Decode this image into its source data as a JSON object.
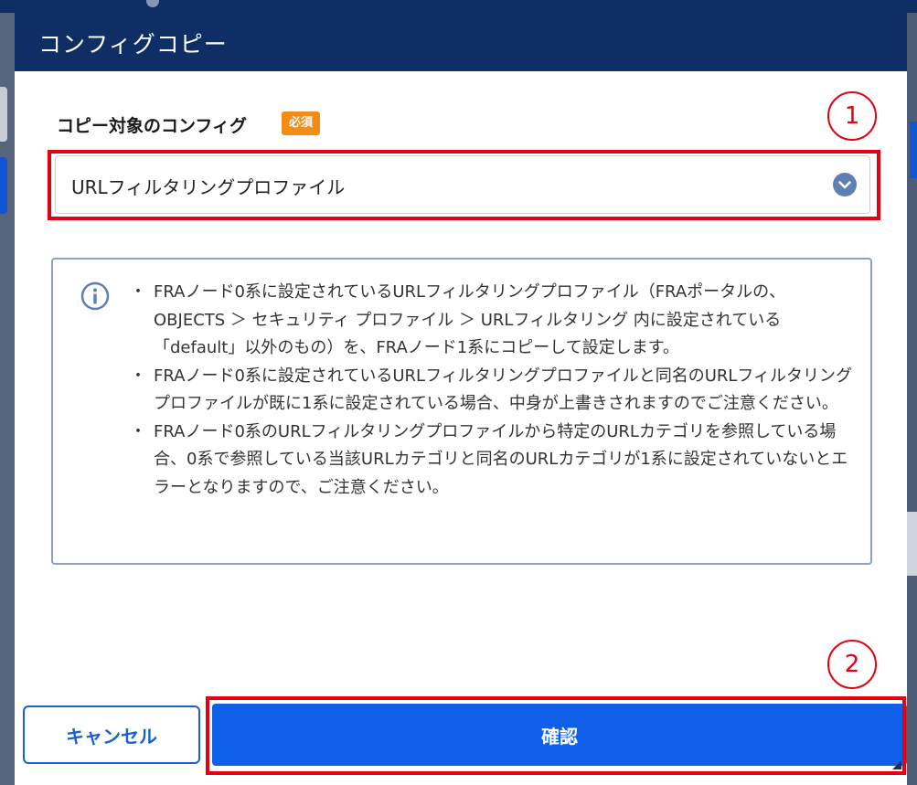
{
  "modal": {
    "title": "コンフィグコピー",
    "field_label": "コピー対象のコンフィグ",
    "required_badge": "必須",
    "select_value": "URLフィルタリングプロファイル",
    "info_notes": [
      "FRAノード0系に設定されているURLフィルタリングプロファイル（FRAポータルの、OBJECTS ＞ セキュリティ プロファイル ＞ URLフィルタリング 内に設定されている「default」以外のもの）を、FRAノード1系にコピーして設定します。",
      "FRAノード0系に設定されているURLフィルタリングプロファイルと同名のURLフィルタリングプロファイルが既に1系に設定されている場合、中身が上書きされますのでご注意ください。",
      "FRAノード0系のURLフィルタリングプロファイルから特定のURLカテゴリを参照している場合、0系で参照している当該URLカテゴリと同名のURLカテゴリが1系に設定されていないとエラーとなりますので、ご注意ください。"
    ],
    "cancel_label": "キャンセル",
    "confirm_label": "確認"
  },
  "annotations": {
    "step1": "1",
    "step2": "2"
  },
  "colors": {
    "header": "#0f2e66",
    "badge": "#f28c16",
    "primary": "#0f5fe8",
    "highlight": "#e60012",
    "info_border": "#8aa2c6"
  },
  "icons": {
    "select_chevron": "chevron-down-icon",
    "info": "info-icon"
  }
}
